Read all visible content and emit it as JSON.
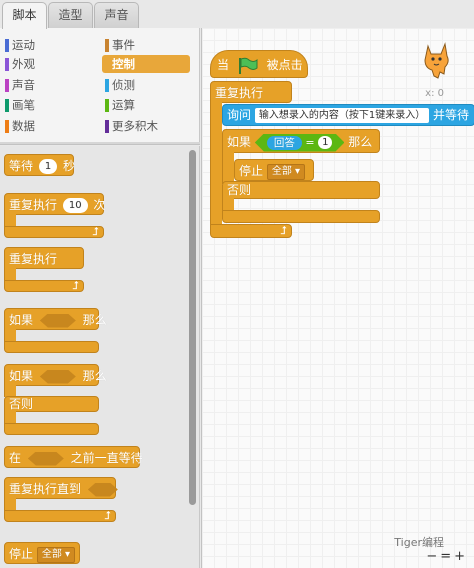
{
  "tabs": [
    {
      "label": "脚本",
      "active": true
    },
    {
      "label": "造型",
      "active": false
    },
    {
      "label": "声音",
      "active": false
    }
  ],
  "categories": [
    {
      "label": "运动",
      "color": "#4a6cd4"
    },
    {
      "label": "事件",
      "color": "#c88330"
    },
    {
      "label": "外观",
      "color": "#8a55d7"
    },
    {
      "label": "控制",
      "color": "#e1a91a",
      "selected": true
    },
    {
      "label": "声音",
      "color": "#bb42c3"
    },
    {
      "label": "侦测",
      "color": "#2ca5e2"
    },
    {
      "label": "画笔",
      "color": "#0e9a6c"
    },
    {
      "label": "运算",
      "color": "#5cb712"
    },
    {
      "label": "数据",
      "color": "#ee7d16"
    },
    {
      "label": "更多积木",
      "color": "#632d99"
    }
  ],
  "palette": {
    "wait_label": "等待",
    "wait_value": "1",
    "wait_unit": "秒",
    "repeat_label": "重复执行",
    "repeat_value": "10",
    "repeat_unit": "次",
    "forever_label": "重复执行",
    "if_label": "如果",
    "then_label": "那么",
    "if2_label": "如果",
    "then2_label": "那么",
    "else_label": "否则",
    "waituntil_label": "在",
    "waituntil_suffix": "之前一直等待",
    "repeatuntil_label": "重复执行直到",
    "stop_label": "停止",
    "stop_option": "全部"
  },
  "script": {
    "hat_when": "当",
    "hat_clicked": "被点击",
    "forever": "重复执行",
    "ask_label": "询问",
    "ask_text": "输入想录入的内容（按下1键来录入）",
    "ask_suffix": "并等待",
    "if_label": "如果",
    "answer": "回答",
    "eq": "=",
    "eq_value": "1",
    "then_label": "那么",
    "stop_label": "停止",
    "stop_option": "全部",
    "else_label": "否则"
  },
  "stage": {
    "x_readout": "x: 0",
    "watermark": "Tiger编程",
    "zoom_controls": "−=+"
  },
  "colors": {
    "control": "#e6a128",
    "sensing": "#2ca5e2",
    "operators": "#5cb712",
    "flag": "#4cbf56"
  }
}
